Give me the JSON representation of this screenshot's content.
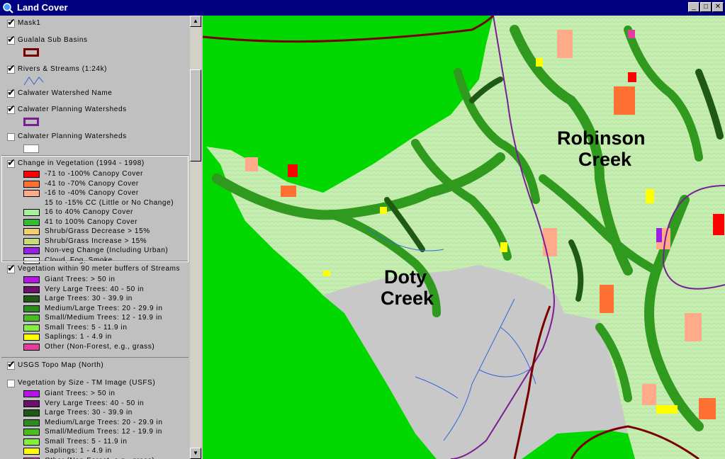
{
  "window": {
    "title": "Land Cover",
    "minimize_glyph": "_",
    "maximize_glyph": "□",
    "close_glyph": "✕"
  },
  "toc": {
    "layers": [
      {
        "name": "Mask1",
        "checked": true
      },
      {
        "name": "Gualala Sub Basins",
        "checked": true
      },
      {
        "name": "Rivers & Streams (1:24k)",
        "checked": true
      },
      {
        "name": "Calwater Watershed Name",
        "checked": true
      },
      {
        "name": "Calwater Planning Watersheds",
        "checked": true
      },
      {
        "name": "Calwater Planning Watersheds",
        "checked": false
      },
      {
        "name": "Change in Vegetation (1994 - 1998)",
        "checked": true,
        "classes": [
          {
            "label": "-71 to -100% Canopy Cover",
            "color": "#ff0000"
          },
          {
            "label": "-41 to -70% Canopy Cover",
            "color": "#ff7033"
          },
          {
            "label": "-16 to -40% Canopy Cover",
            "color": "#ffaa88"
          },
          {
            "label": "15 to -15% CC (Little or No Change)",
            "color": ""
          },
          {
            "label": "16 to 40% Canopy Cover",
            "color": "#a6f29a"
          },
          {
            "label": "41 to 100% Canopy Cover",
            "color": "#33bb33"
          },
          {
            "label": "Shrub/Grass Decrease > 15%",
            "color": "#f2cf6b"
          },
          {
            "label": "Shrub/Grass Increase > 15%",
            "color": "#c8dc78"
          },
          {
            "label": "Non-veg Change (Including Urban)",
            "color": "#9b1ee6"
          },
          {
            "label": "Cloud, Fog, Smoke",
            "color": "#e6e6e6"
          }
        ]
      },
      {
        "name": "Vegetation within 90 meter buffers of Streams",
        "checked": true,
        "classes": [
          {
            "label": "Giant Trees: > 50 in",
            "color": "#b414e6"
          },
          {
            "label": "Very Large Trees: 40 - 50 in",
            "color": "#6e0f6e"
          },
          {
            "label": "Large Trees: 30 - 39.9 in",
            "color": "#1e5a14"
          },
          {
            "label": "Medium/Large Trees: 20 - 29.9 in",
            "color": "#2d8c1e"
          },
          {
            "label": "Small/Medium Trees: 12 - 19.9 in",
            "color": "#46be1e"
          },
          {
            "label": "Small Trees: 5 - 11.9 in",
            "color": "#82f03c"
          },
          {
            "label": "Saplings: 1 - 4.9 in",
            "color": "#ffff00"
          },
          {
            "label": "Other (Non-Forest, e.g., grass)",
            "color": "#e63ca0"
          }
        ]
      },
      {
        "name": "USGS Topo Map (North)",
        "checked": true
      },
      {
        "name": "Vegetation by Size - TM Image (USFS)",
        "checked": false,
        "classes": [
          {
            "label": "Giant Trees: > 50 in",
            "color": "#b414e6"
          },
          {
            "label": "Very Large Trees: 40 - 50 in",
            "color": "#6e0f6e"
          },
          {
            "label": "Large Trees: 30 - 39.9 in",
            "color": "#1e5a14"
          },
          {
            "label": "Medium/Large Trees: 20 - 29.9 in",
            "color": "#2d8c1e"
          },
          {
            "label": "Small/Medium Trees: 12 - 19.9 in",
            "color": "#46be1e"
          },
          {
            "label": "Small Trees: 5 - 11.9 in",
            "color": "#82f03c"
          },
          {
            "label": "Saplings: 1 - 4.9 in",
            "color": "#ffff00"
          },
          {
            "label": "Other (Non-Forest, e.g., grass)",
            "color": "#e63ca0"
          }
        ]
      }
    ]
  },
  "map": {
    "labels": {
      "robinson": [
        "Robinson",
        "Creek"
      ],
      "doty": [
        "Doty",
        "Creek"
      ]
    },
    "colors": {
      "mask": "#00d800",
      "terrain": "#c6eeb0",
      "riparian": "#2f9a1e",
      "riparian_dark": "#1e5a14",
      "gray_area": "#c8c8c8",
      "boundary": "#7a0000",
      "watershed": "#7a1e96",
      "stream": "#3264dc"
    }
  }
}
